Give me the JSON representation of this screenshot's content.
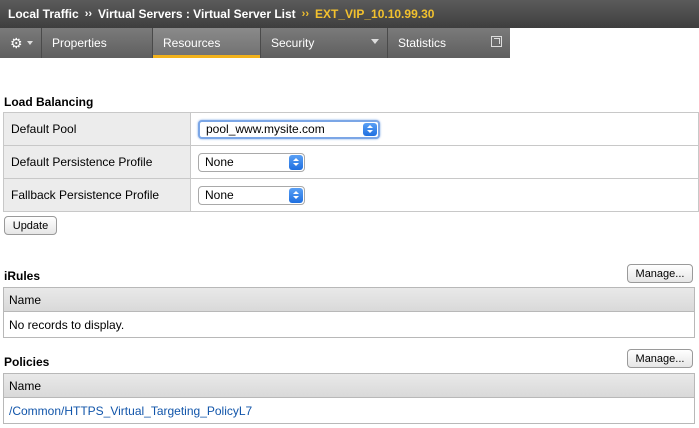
{
  "breadcrumb": {
    "items": [
      "Local Traffic",
      "Virtual Servers : Virtual Server List"
    ],
    "separator": "››",
    "current": "EXT_VIP_10.10.99.30"
  },
  "tabs": {
    "properties": "Properties",
    "resources": "Resources",
    "security": "Security",
    "statistics": "Statistics",
    "active": "Resources"
  },
  "load_balancing": {
    "title": "Load Balancing",
    "rows": [
      {
        "label": "Default Pool",
        "value": "pool_www.mysite.com"
      },
      {
        "label": "Default Persistence Profile",
        "value": "None"
      },
      {
        "label": "Fallback Persistence Profile",
        "value": "None"
      }
    ],
    "update_label": "Update"
  },
  "irules": {
    "title": "iRules",
    "manage_label": "Manage...",
    "column": "Name",
    "empty_text": "No records to display."
  },
  "policies": {
    "title": "Policies",
    "manage_label": "Manage...",
    "column": "Name",
    "rows": [
      "/Common/HTTPS_Virtual_Targeting_PolicyL7"
    ]
  },
  "colors": {
    "accent": "#f2b21b",
    "breadcrumb_current": "#f2c12e",
    "link": "#1155aa",
    "select_focus": "#7ba6e6"
  }
}
